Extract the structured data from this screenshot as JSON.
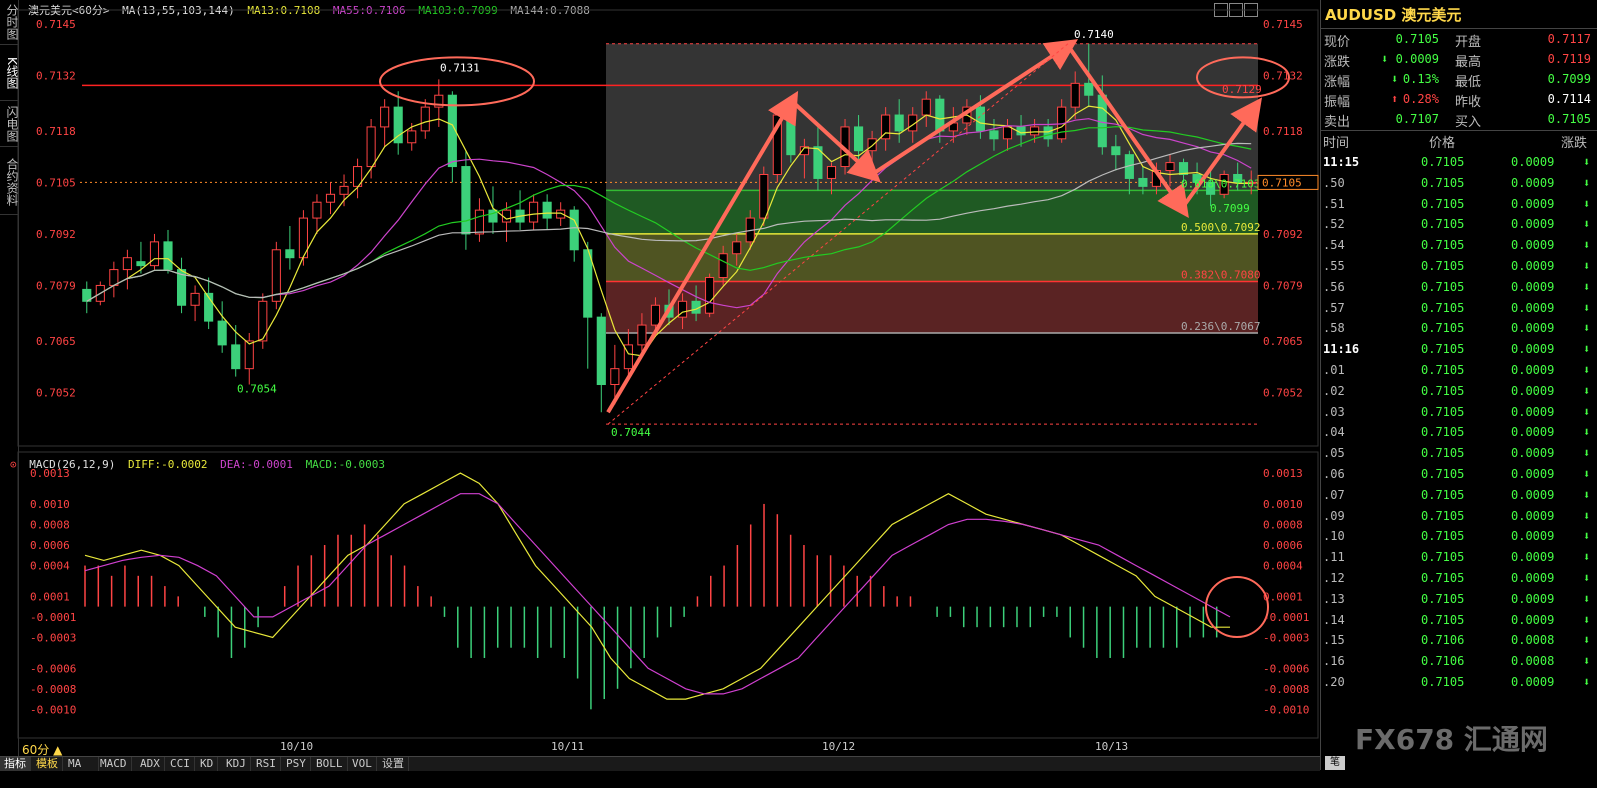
{
  "left_tabs": [
    "分时图",
    "K线图",
    "闪电图",
    "合约资料"
  ],
  "kline_header": {
    "symbol": "澳元美元<60分>",
    "ma_label": "MA(13,55,103,144)",
    "ma13": "MA13:0.7108",
    "ma55": "MA55:0.7106",
    "ma103": "MA103:0.7099",
    "ma144": "MA144:0.7088"
  },
  "macd_header": {
    "title": "MACD(26,12,9)",
    "diff": "DIFF:-0.0002",
    "dea": "DEA:-0.0001",
    "macd": "MACD:-0.0003"
  },
  "colors": {
    "up": "#ff4444",
    "down": "#3cd07a",
    "ma13": "#e8e83a",
    "ma55": "#bbbbbb",
    "ma103": "#22cc22",
    "ma144": "#cc44cc",
    "annot": "#ff6a5a",
    "accent": "#ffd84a"
  },
  "kline_axis": {
    "min": 0.704,
    "max": 0.7148,
    "left_ticks": [
      "0.7145",
      "0.7132",
      "0.7118",
      "0.7105",
      "0.7092",
      "0.7079",
      "0.7065",
      "0.7052"
    ],
    "right_ticks": [
      "0.7145",
      "0.7132",
      "0.7118",
      "0.7105",
      "0.7092",
      "0.7079",
      "0.7065",
      "0.7052"
    ],
    "tick_values": [
      0.7145,
      0.7132,
      0.7118,
      0.7105,
      0.7092,
      0.7079,
      0.7065,
      0.7052
    ],
    "current_price": "0.7105"
  },
  "macd_axis": {
    "min": -0.00125,
    "max": 0.00135,
    "left_ticks": [
      "0.0013",
      "0.0010",
      "0.0008",
      "0.0006",
      "0.0004",
      "0.0001",
      "-0.0001",
      "-0.0003",
      "-0.0006",
      "-0.0008",
      "-0.0010"
    ],
    "right_ticks": [
      "0.0013",
      "0.0010",
      "0.0008",
      "0.0006",
      "0.0004",
      "0.0001",
      "-0.0001",
      "-0.0003",
      "-0.0006",
      "-0.0008",
      "-0.0010"
    ],
    "tick_values": [
      0.0013,
      0.001,
      0.0008,
      0.0006,
      0.0004,
      0.0001,
      -0.0001,
      -0.0003,
      -0.0006,
      -0.0008,
      -0.001
    ]
  },
  "annotations": {
    "high_label": "0.7131",
    "low_left": "0.7054",
    "low_main": "0.7044",
    "peak": "0.7140",
    "dip": "0.7099",
    "target": "0.7129",
    "fib_618": "0.618\\0.7103",
    "fib_500": "0.500\\0.7092",
    "fib_382": "0.382\\0.7080",
    "fib_236": "0.236\\0.7067"
  },
  "dates": [
    "10/10",
    "10/11",
    "10/12",
    "10/13"
  ],
  "timeframe": "60分 ▲",
  "bottom_tabs": [
    "指标",
    "模板",
    "MA",
    "MACD",
    "ADX",
    "CCI",
    "KD",
    "KDJ",
    "RSI",
    "PSY",
    "BOLL",
    "VOL",
    "设置"
  ],
  "quote": {
    "title": "AUDUSD 澳元美元",
    "rows": [
      {
        "l1": "现价",
        "v1": "0.7105",
        "c1": "#44ff44",
        "l2": "开盘",
        "v2": "0.7117",
        "c2": "#ff4444"
      },
      {
        "l1": "涨跌",
        "v1": "0.0009",
        "c1": "#44ff44",
        "l2": "最高",
        "v2": "0.7119",
        "c2": "#ff4444"
      },
      {
        "l1": "涨幅",
        "v1": "0.13%",
        "c1": "#44ff44",
        "l2": "最低",
        "v2": "0.7099",
        "c2": "#44ff44"
      },
      {
        "l1": "振幅",
        "v1": "0.28%",
        "c1": "#ff4444",
        "l2": "昨收",
        "v2": "0.7114",
        "c2": "#ffffff"
      },
      {
        "l1": "卖出",
        "v1": "0.7107",
        "c1": "#44ff44",
        "l2": "买入",
        "v2": "0.7105",
        "c2": "#44ff44"
      }
    ],
    "tick_header": {
      "time": "时间",
      "price": "价格",
      "change": "涨跌"
    },
    "ticks": [
      {
        "time": "11:15",
        "price": "0.7105",
        "change": "0.0009"
      },
      {
        "time": ".50",
        "price": "0.7105",
        "change": "0.0009"
      },
      {
        "time": ".51",
        "price": "0.7105",
        "change": "0.0009"
      },
      {
        "time": ".52",
        "price": "0.7105",
        "change": "0.0009"
      },
      {
        "time": ".54",
        "price": "0.7105",
        "change": "0.0009"
      },
      {
        "time": ".55",
        "price": "0.7105",
        "change": "0.0009"
      },
      {
        "time": ".56",
        "price": "0.7105",
        "change": "0.0009"
      },
      {
        "time": ".57",
        "price": "0.7105",
        "change": "0.0009"
      },
      {
        "time": ".58",
        "price": "0.7105",
        "change": "0.0009"
      },
      {
        "time": "11:16",
        "price": "0.7105",
        "change": "0.0009"
      },
      {
        "time": ".01",
        "price": "0.7105",
        "change": "0.0009"
      },
      {
        "time": ".02",
        "price": "0.7105",
        "change": "0.0009"
      },
      {
        "time": ".03",
        "price": "0.7105",
        "change": "0.0009"
      },
      {
        "time": ".04",
        "price": "0.7105",
        "change": "0.0009"
      },
      {
        "time": ".05",
        "price": "0.7105",
        "change": "0.0009"
      },
      {
        "time": ".06",
        "price": "0.7105",
        "change": "0.0009"
      },
      {
        "time": ".07",
        "price": "0.7105",
        "change": "0.0009"
      },
      {
        "time": ".09",
        "price": "0.7105",
        "change": "0.0009"
      },
      {
        "time": ".10",
        "price": "0.7105",
        "change": "0.0009"
      },
      {
        "time": ".11",
        "price": "0.7105",
        "change": "0.0009"
      },
      {
        "time": ".12",
        "price": "0.7105",
        "change": "0.0009"
      },
      {
        "time": ".13",
        "price": "0.7105",
        "change": "0.0009"
      },
      {
        "time": ".14",
        "price": "0.7105",
        "change": "0.0009"
      },
      {
        "time": ".15",
        "price": "0.7106",
        "change": "0.0008"
      },
      {
        "time": ".16",
        "price": "0.7106",
        "change": "0.0008"
      },
      {
        "time": ".20",
        "price": "0.7105",
        "change": "0.0009"
      }
    ]
  },
  "side_button": "笔",
  "watermark": "FX678 汇通网",
  "chart_data": {
    "type": "candlestick",
    "title": "澳元美元<60分>",
    "ylim": [
      0.704,
      0.7148
    ],
    "candles": [
      [
        0.7078,
        0.708,
        0.7072,
        0.7075
      ],
      [
        0.7075,
        0.708,
        0.7074,
        0.7079
      ],
      [
        0.7079,
        0.7085,
        0.7076,
        0.7083
      ],
      [
        0.7083,
        0.7088,
        0.7078,
        0.7086
      ],
      [
        0.7085,
        0.709,
        0.7082,
        0.7084
      ],
      [
        0.7084,
        0.7092,
        0.7083,
        0.709
      ],
      [
        0.709,
        0.7093,
        0.7082,
        0.7083
      ],
      [
        0.7083,
        0.7086,
        0.7072,
        0.7074
      ],
      [
        0.7074,
        0.7079,
        0.707,
        0.7077
      ],
      [
        0.7077,
        0.7081,
        0.7068,
        0.707
      ],
      [
        0.707,
        0.7075,
        0.7062,
        0.7064
      ],
      [
        0.7064,
        0.7069,
        0.7056,
        0.7058
      ],
      [
        0.7058,
        0.7067,
        0.7054,
        0.7065
      ],
      [
        0.7065,
        0.7077,
        0.7063,
        0.7075
      ],
      [
        0.7075,
        0.709,
        0.7073,
        0.7088
      ],
      [
        0.7088,
        0.7094,
        0.7083,
        0.7086
      ],
      [
        0.7086,
        0.7098,
        0.7084,
        0.7096
      ],
      [
        0.7096,
        0.7102,
        0.7092,
        0.71
      ],
      [
        0.71,
        0.7105,
        0.7097,
        0.7102
      ],
      [
        0.7102,
        0.7107,
        0.7099,
        0.7104
      ],
      [
        0.7104,
        0.7111,
        0.7101,
        0.7109
      ],
      [
        0.7109,
        0.7121,
        0.7106,
        0.7119
      ],
      [
        0.7119,
        0.7126,
        0.7114,
        0.7124
      ],
      [
        0.7124,
        0.7128,
        0.7112,
        0.7115
      ],
      [
        0.7115,
        0.712,
        0.7113,
        0.7118
      ],
      [
        0.7118,
        0.7126,
        0.7116,
        0.7124
      ],
      [
        0.7124,
        0.7131,
        0.7119,
        0.7127
      ],
      [
        0.7127,
        0.7128,
        0.7105,
        0.7109
      ],
      [
        0.7109,
        0.7113,
        0.7088,
        0.7092
      ],
      [
        0.7092,
        0.7101,
        0.709,
        0.7098
      ],
      [
        0.7098,
        0.7104,
        0.7092,
        0.7095
      ],
      [
        0.7095,
        0.71,
        0.709,
        0.7098
      ],
      [
        0.7098,
        0.7103,
        0.7093,
        0.7095
      ],
      [
        0.7095,
        0.7102,
        0.7093,
        0.71
      ],
      [
        0.71,
        0.7102,
        0.7093,
        0.7096
      ],
      [
        0.7096,
        0.71,
        0.7094,
        0.7098
      ],
      [
        0.7098,
        0.7099,
        0.7085,
        0.7088
      ],
      [
        0.7088,
        0.709,
        0.7058,
        0.7071
      ],
      [
        0.7071,
        0.7072,
        0.7047,
        0.7054
      ],
      [
        0.7054,
        0.7064,
        0.7049,
        0.7058
      ],
      [
        0.7058,
        0.7068,
        0.7055,
        0.7064
      ],
      [
        0.7064,
        0.7072,
        0.7061,
        0.7069
      ],
      [
        0.7069,
        0.7076,
        0.7066,
        0.7074
      ],
      [
        0.7074,
        0.7078,
        0.7069,
        0.7071
      ],
      [
        0.7071,
        0.7077,
        0.7068,
        0.7075
      ],
      [
        0.7075,
        0.7079,
        0.707,
        0.7072
      ],
      [
        0.7072,
        0.7082,
        0.7071,
        0.7081
      ],
      [
        0.7081,
        0.7089,
        0.7079,
        0.7087
      ],
      [
        0.7087,
        0.7092,
        0.7084,
        0.709
      ],
      [
        0.709,
        0.7098,
        0.7088,
        0.7096
      ],
      [
        0.7096,
        0.7109,
        0.7094,
        0.7107
      ],
      [
        0.7107,
        0.7124,
        0.7105,
        0.7122
      ],
      [
        0.7122,
        0.7125,
        0.711,
        0.7112
      ],
      [
        0.7112,
        0.7116,
        0.7106,
        0.7114
      ],
      [
        0.7114,
        0.7119,
        0.7103,
        0.7106
      ],
      [
        0.7106,
        0.711,
        0.7102,
        0.7109
      ],
      [
        0.7109,
        0.7121,
        0.7107,
        0.7119
      ],
      [
        0.7119,
        0.7122,
        0.711,
        0.7113
      ],
      [
        0.7113,
        0.7118,
        0.7109,
        0.7116
      ],
      [
        0.7116,
        0.7124,
        0.7113,
        0.7122
      ],
      [
        0.7122,
        0.7126,
        0.7115,
        0.7118
      ],
      [
        0.7118,
        0.7124,
        0.7115,
        0.7122
      ],
      [
        0.7122,
        0.7128,
        0.7119,
        0.7126
      ],
      [
        0.7126,
        0.7127,
        0.7115,
        0.7118
      ],
      [
        0.7118,
        0.7124,
        0.7115,
        0.712
      ],
      [
        0.712,
        0.7126,
        0.7117,
        0.7124
      ],
      [
        0.7124,
        0.7127,
        0.7116,
        0.7118
      ],
      [
        0.7118,
        0.7121,
        0.7113,
        0.7116
      ],
      [
        0.7116,
        0.7121,
        0.7113,
        0.7119
      ],
      [
        0.7119,
        0.7122,
        0.7114,
        0.7117
      ],
      [
        0.7117,
        0.7121,
        0.7115,
        0.7119
      ],
      [
        0.7119,
        0.7121,
        0.7114,
        0.7116
      ],
      [
        0.7116,
        0.7126,
        0.7115,
        0.7124
      ],
      [
        0.7124,
        0.7133,
        0.7121,
        0.713
      ],
      [
        0.713,
        0.714,
        0.7124,
        0.7127
      ],
      [
        0.7127,
        0.7132,
        0.7112,
        0.7114
      ],
      [
        0.7114,
        0.7117,
        0.7108,
        0.7112
      ],
      [
        0.7112,
        0.7113,
        0.7102,
        0.7106
      ],
      [
        0.7106,
        0.7109,
        0.7102,
        0.7104
      ],
      [
        0.7104,
        0.711,
        0.7102,
        0.7108
      ],
      [
        0.7108,
        0.7112,
        0.7104,
        0.711
      ],
      [
        0.711,
        0.7111,
        0.7105,
        0.7107
      ],
      [
        0.7107,
        0.711,
        0.7102,
        0.7105
      ],
      [
        0.7105,
        0.7108,
        0.7099,
        0.7102
      ],
      [
        0.7102,
        0.7108,
        0.7101,
        0.7107
      ],
      [
        0.7107,
        0.711,
        0.7103,
        0.7105
      ],
      [
        0.7105,
        0.7108,
        0.7102,
        0.7105
      ]
    ],
    "macd_hist": [
      0.0004,
      0.0004,
      0.0003,
      0.0004,
      0.0003,
      0.0003,
      0.0002,
      0.0001,
      0.0,
      -0.0001,
      -0.0003,
      -0.0005,
      -0.0004,
      -0.0002,
      0.0,
      0.0002,
      0.0004,
      0.0005,
      0.0006,
      0.0007,
      0.0007,
      0.0008,
      0.0007,
      0.0005,
      0.0004,
      0.0002,
      0.0001,
      -0.0001,
      -0.0004,
      -0.0005,
      -0.0005,
      -0.0004,
      -0.0004,
      -0.0004,
      -0.0005,
      -0.0004,
      -0.0005,
      -0.0007,
      -0.001,
      -0.0009,
      -0.0008,
      -0.0006,
      -0.0005,
      -0.0003,
      -0.0002,
      -0.0001,
      0.0001,
      0.0003,
      0.0004,
      0.0006,
      0.0008,
      0.001,
      0.0009,
      0.0007,
      0.0006,
      0.0005,
      0.0005,
      0.0004,
      0.0003,
      0.0003,
      0.0002,
      0.0001,
      0.0001,
      0.0,
      -0.0001,
      -0.0001,
      -0.0002,
      -0.0002,
      -0.0002,
      -0.0002,
      -0.0002,
      -0.0002,
      -0.0001,
      -0.0001,
      -0.0003,
      -0.0004,
      -0.0005,
      -0.0005,
      -0.0005,
      -0.0004,
      -0.0004,
      -0.0004,
      -0.0004,
      -0.0003,
      -0.0003,
      -0.0003
    ],
    "diff": [
      0.0005,
      0.00045,
      0.0005,
      0.00055,
      0.0005,
      0.0004,
      0.0002,
      0.0,
      -0.0002,
      -0.00025,
      -0.0003,
      -0.0001,
      0.0001,
      0.0003,
      0.0005,
      0.0006,
      0.0008,
      0.001,
      0.0011,
      0.0012,
      0.0013,
      0.0012,
      0.001,
      0.0007,
      0.0004,
      0.0002,
      0.0,
      -0.0002,
      -0.0005,
      -0.0007,
      -0.0008,
      -0.0009,
      -0.0009,
      -0.00085,
      -0.0008,
      -0.0007,
      -0.0006,
      -0.0004,
      -0.0002,
      0.0,
      0.0002,
      0.0004,
      0.0006,
      0.0008,
      0.0009,
      0.001,
      0.0011,
      0.001,
      0.0009,
      0.00085,
      0.0008,
      0.00075,
      0.0007,
      0.0006,
      0.0005,
      0.0004,
      0.0003,
      0.0001,
      0.0,
      -0.0001,
      -0.0002,
      -0.0002
    ],
    "dea": [
      0.00035,
      0.0004,
      0.00045,
      0.00048,
      0.0005,
      0.00048,
      0.0004,
      0.0003,
      0.0001,
      -0.0001,
      -0.0001,
      0.0,
      0.0001,
      0.0002,
      0.0004,
      0.0006,
      0.0007,
      0.0008,
      0.0009,
      0.001,
      0.0011,
      0.0011,
      0.001,
      0.0008,
      0.0006,
      0.0004,
      0.0002,
      0.0,
      -0.0002,
      -0.0004,
      -0.0006,
      -0.0007,
      -0.0008,
      -0.00085,
      -0.00085,
      -0.0008,
      -0.0007,
      -0.0006,
      -0.0005,
      -0.0003,
      -0.0001,
      0.0001,
      0.0003,
      0.0005,
      0.0006,
      0.0007,
      0.0008,
      0.00085,
      0.00085,
      0.00083,
      0.0008,
      0.00075,
      0.0007,
      0.00065,
      0.0006,
      0.0005,
      0.0004,
      0.0003,
      0.0002,
      0.0001,
      0.0,
      -0.0001
    ]
  }
}
